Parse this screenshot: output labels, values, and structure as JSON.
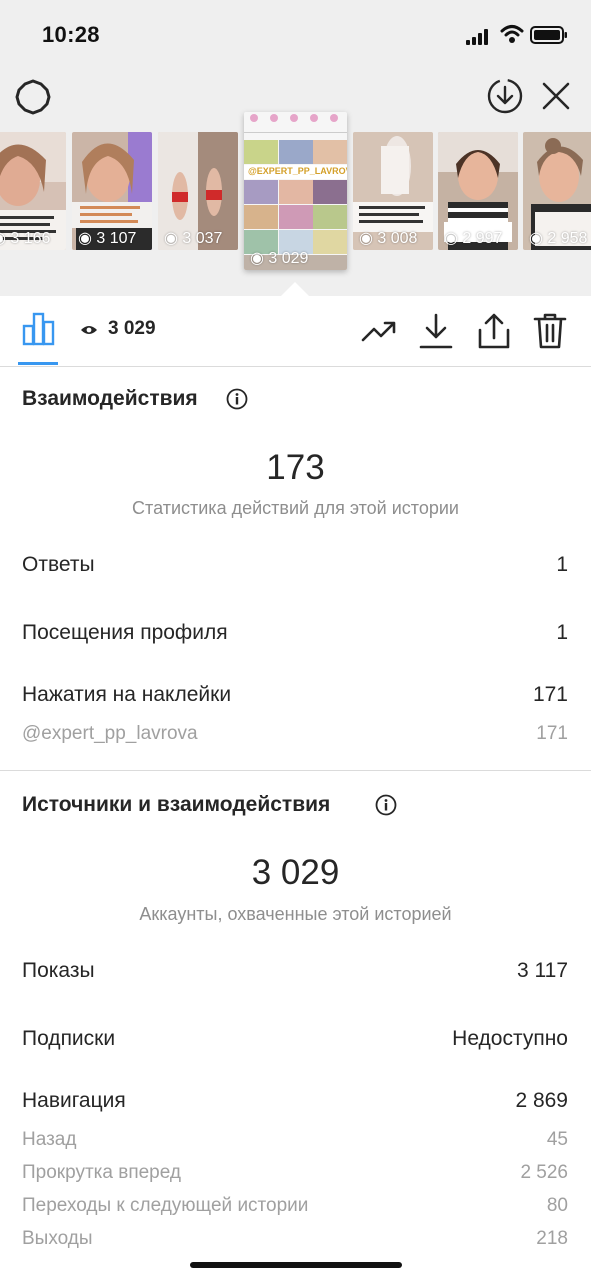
{
  "status_bar": {
    "time": "10:28"
  },
  "thumbnails": [
    {
      "views": "3 166",
      "bg": "#c9b3a6"
    },
    {
      "views": "3 107",
      "bg": "#b79d8d"
    },
    {
      "views": "3 037",
      "bg": "#cfc4bd"
    },
    {
      "views": "3 029",
      "bg": "#f4f4f4",
      "active": true,
      "banner": "@EXPERT_PP_LAVROVA"
    },
    {
      "views": "3 008",
      "bg": "#d8c9bf"
    },
    {
      "views": "2 997",
      "bg": "#a89386"
    },
    {
      "views": "2 958",
      "bg": "#b8a698"
    }
  ],
  "toolbar": {
    "views": "3 029"
  },
  "interactions": {
    "title": "Взаимодействия",
    "total": "173",
    "subtitle": "Статистика действий для этой истории",
    "rows": [
      {
        "label": "Ответы",
        "value": "1"
      },
      {
        "label": "Посещения профиля",
        "value": "1"
      },
      {
        "label": "Нажатия на наклейки",
        "value": "171"
      }
    ],
    "sticker": {
      "label": "@expert_pp_lavrova",
      "value": "171"
    }
  },
  "discovery": {
    "title": "Источники и взаимодействия",
    "total": "3 029",
    "subtitle": "Аккаунты, охваченные этой историей",
    "rows": [
      {
        "label": "Показы",
        "value": "3 117"
      },
      {
        "label": "Подписки",
        "value": "Недоступно"
      },
      {
        "label": "Навигация",
        "value": "2 869"
      }
    ],
    "navigation": [
      {
        "label": "Назад",
        "value": "45"
      },
      {
        "label": "Прокрутка вперед",
        "value": "2 526"
      },
      {
        "label": "Переходы к следующей истории",
        "value": "80"
      },
      {
        "label": "Выходы",
        "value": "218"
      }
    ]
  },
  "colors": {
    "accent": "#3897f0",
    "text": "#262626",
    "muted": "#8e8e8e"
  }
}
